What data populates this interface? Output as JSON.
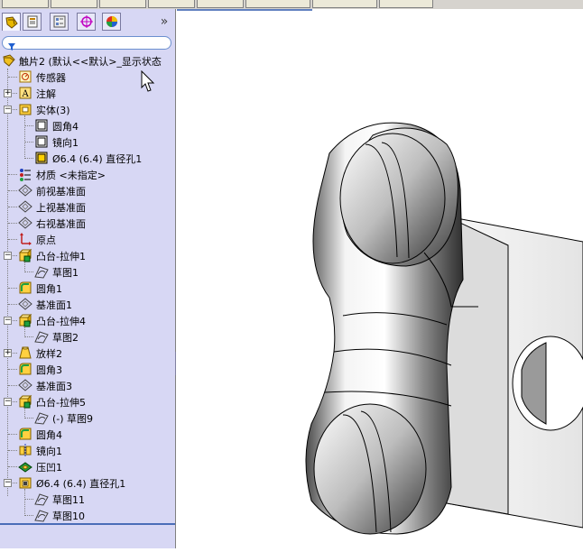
{
  "feature_manager": {
    "toolbar_buttons": [
      {
        "name": "feature-manager-tab",
        "icon": "featuremanager-icon"
      },
      {
        "name": "property-manager-tab",
        "icon": "propertymanager-icon"
      },
      {
        "name": "configuration-manager-tab",
        "icon": "configurationmanager-icon"
      },
      {
        "name": "dimxpert-manager-tab",
        "icon": "dimxpert-icon"
      },
      {
        "name": "display-manager-tab",
        "icon": "displaymanager-icon"
      }
    ],
    "more_label": "»",
    "filter_placeholder": ""
  },
  "tree": {
    "root": {
      "label": "触片2  (默认<<默认>_显示状态",
      "icon": "part-icon"
    },
    "items": [
      {
        "label": "传感器",
        "icon": "sensor-icon",
        "level": 1,
        "expander": ""
      },
      {
        "label": "注解",
        "icon": "annotation-icon",
        "level": 1,
        "expander": "+"
      },
      {
        "label": "实体(3)",
        "icon": "solid-bodies-icon",
        "level": 1,
        "expander": "−"
      },
      {
        "label": "圆角4",
        "icon": "body-icon",
        "level": 2,
        "expander": ""
      },
      {
        "label": "镜向1",
        "icon": "body-icon",
        "level": 2,
        "expander": ""
      },
      {
        "label": "Ø6.4 (6.4) 直径孔1",
        "icon": "body-selected-icon",
        "level": 2,
        "expander": ""
      },
      {
        "label": "材质 <未指定>",
        "icon": "material-icon",
        "level": 1,
        "expander": ""
      },
      {
        "label": "前视基准面",
        "icon": "plane-icon",
        "level": 1,
        "expander": ""
      },
      {
        "label": "上视基准面",
        "icon": "plane-icon",
        "level": 1,
        "expander": ""
      },
      {
        "label": "右视基准面",
        "icon": "plane-icon",
        "level": 1,
        "expander": ""
      },
      {
        "label": "原点",
        "icon": "origin-icon",
        "level": 1,
        "expander": ""
      },
      {
        "label": "凸台-拉伸1",
        "icon": "boss-extrude-icon",
        "level": 1,
        "expander": "−"
      },
      {
        "label": "草图1",
        "icon": "sketch-icon",
        "level": 2,
        "expander": ""
      },
      {
        "label": "圆角1",
        "icon": "fillet-icon",
        "level": 1,
        "expander": ""
      },
      {
        "label": "基准面1",
        "icon": "plane-icon",
        "level": 1,
        "expander": ""
      },
      {
        "label": "凸台-拉伸4",
        "icon": "boss-extrude-icon",
        "level": 1,
        "expander": "−"
      },
      {
        "label": "草图2",
        "icon": "sketch-icon",
        "level": 2,
        "expander": ""
      },
      {
        "label": "放样2",
        "icon": "loft-icon",
        "level": 1,
        "expander": "+"
      },
      {
        "label": "圆角3",
        "icon": "fillet-icon",
        "level": 1,
        "expander": ""
      },
      {
        "label": "基准面3",
        "icon": "plane-icon",
        "level": 1,
        "expander": ""
      },
      {
        "label": "凸台-拉伸5",
        "icon": "boss-extrude-icon",
        "level": 1,
        "expander": "−"
      },
      {
        "label": "(-) 草图9",
        "icon": "sketch-icon",
        "level": 2,
        "expander": ""
      },
      {
        "label": "圆角4",
        "icon": "fillet-icon",
        "level": 1,
        "expander": ""
      },
      {
        "label": "镜向1",
        "icon": "mirror-icon",
        "level": 1,
        "expander": ""
      },
      {
        "label": "压凹1",
        "icon": "indent-icon",
        "level": 1,
        "expander": ""
      },
      {
        "label": "Ø6.4 (6.4) 直径孔1",
        "icon": "hole-icon",
        "level": 1,
        "expander": "−"
      },
      {
        "label": "草图11",
        "icon": "sketch-icon",
        "level": 2,
        "expander": ""
      },
      {
        "label": "草图10",
        "icon": "sketch-icon",
        "level": 2,
        "expander": ""
      }
    ]
  },
  "viewport": {
    "model_name": "part-model-render"
  },
  "colors": {
    "pane_bg": "#d7d7f4",
    "accent": "#4a6db8",
    "model_light": "#f2f2f2",
    "model_dark": "#3a3a3a"
  }
}
